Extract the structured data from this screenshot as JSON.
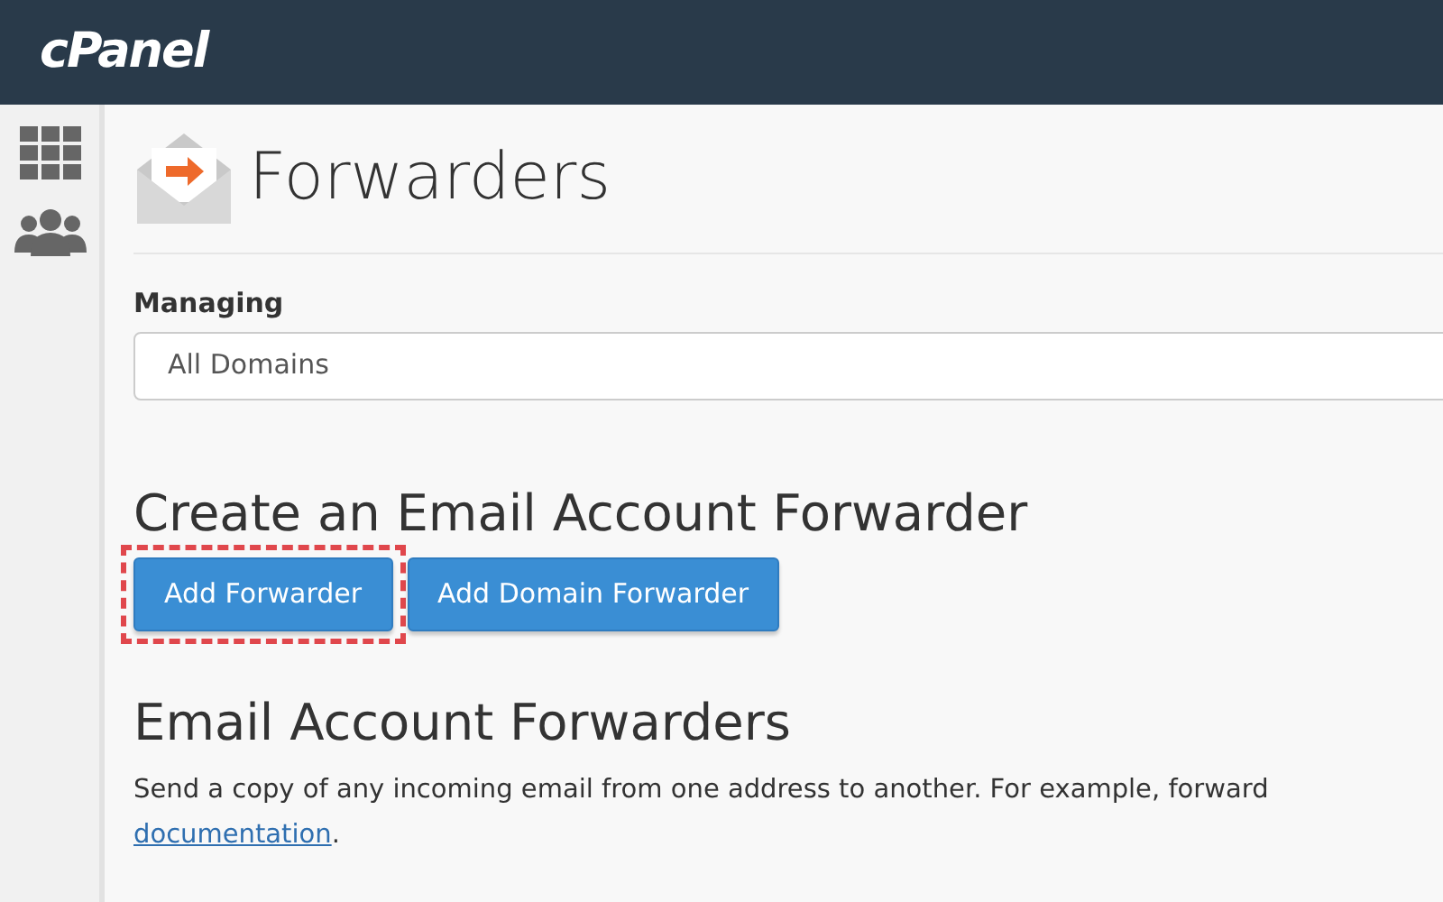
{
  "header": {
    "logo": "cPanel"
  },
  "sidebar": {
    "items": [
      {
        "kind": "grid"
      },
      {
        "kind": "users"
      }
    ]
  },
  "page": {
    "title": "Forwarders"
  },
  "managing": {
    "label": "Managing",
    "value": "All Domains"
  },
  "create_section": {
    "heading": "Create an Email Account Forwarder",
    "buttons": [
      {
        "label": "Add Forwarder",
        "highlighted": true
      },
      {
        "label": "Add Domain Forwarder",
        "highlighted": false
      }
    ]
  },
  "forwarders_section": {
    "heading": "Email Account Forwarders",
    "description": "Send a copy of any incoming email from one address to another. For example, forward",
    "link": "documentation",
    "link_suffix": "."
  }
}
